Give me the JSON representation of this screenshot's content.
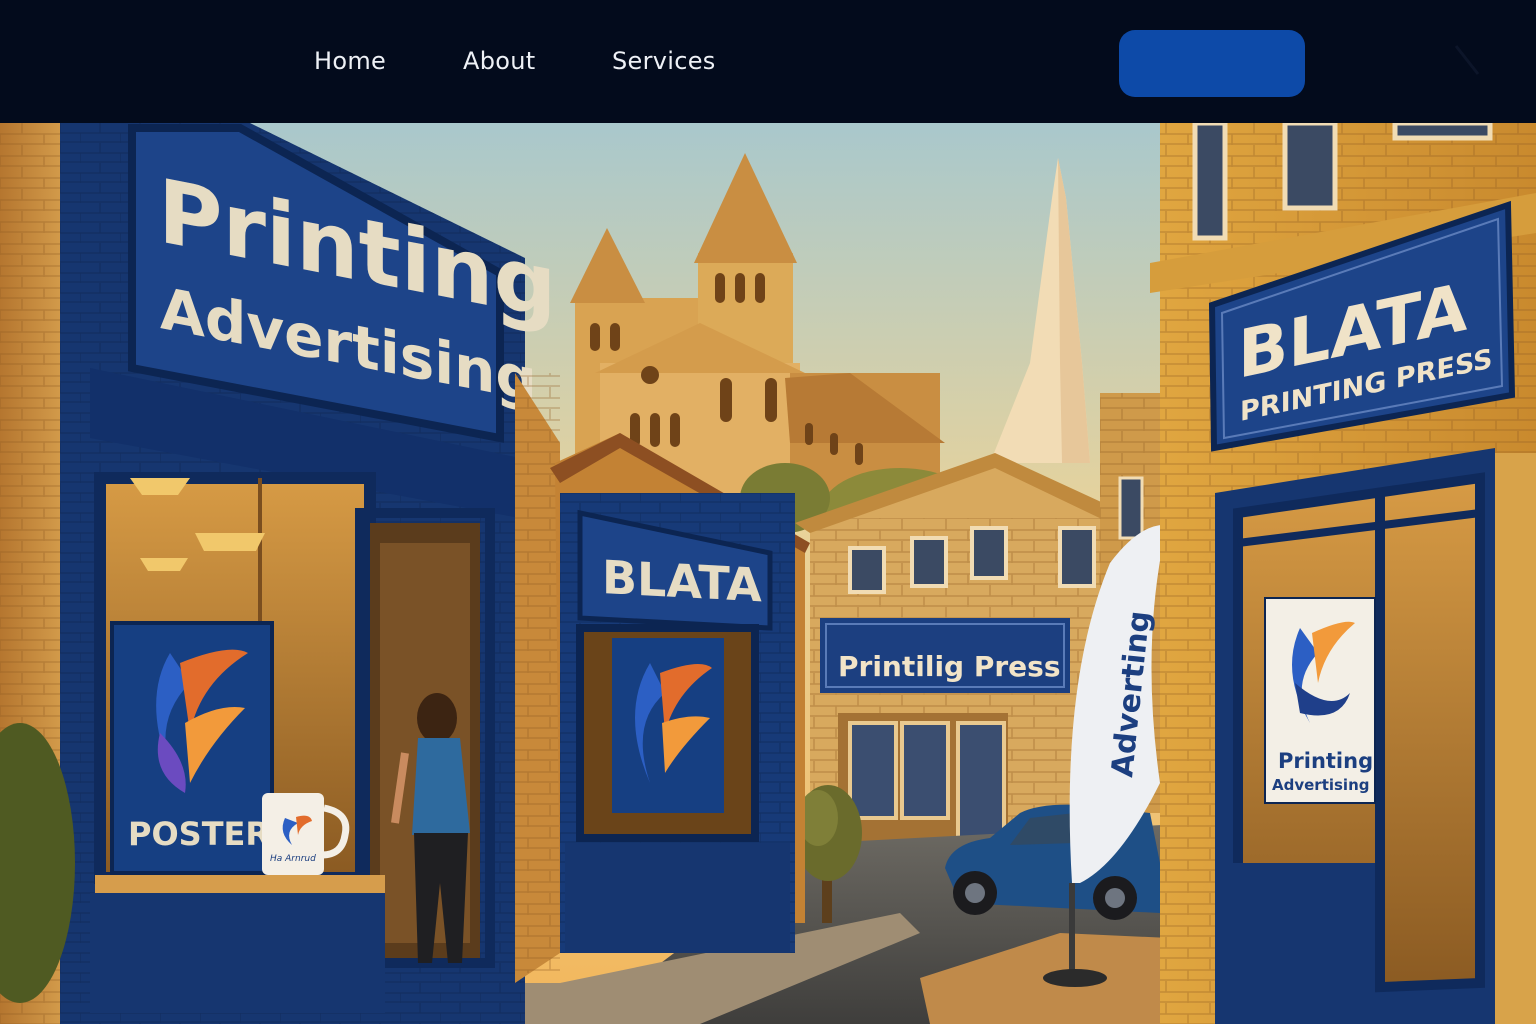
{
  "nav": {
    "links": [
      {
        "label": "Home"
      },
      {
        "label": "About"
      },
      {
        "label": "Services"
      }
    ],
    "cta_label": "",
    "bg_color": "#030b1c",
    "cta_color": "#0d4aa8",
    "menu_icon": "menu-icon"
  },
  "hero": {
    "left_sign": {
      "line1": "Printing",
      "line2": "Advertising"
    },
    "left_poster": {
      "label": "POSTER",
      "icon": "flame-leaf-logo"
    },
    "mug": {
      "label": "Ha Arnrud",
      "icon": "mug-logo"
    },
    "center_sign": {
      "label": "BLATA"
    },
    "small_shop_sign": {
      "label": "Printilig Press"
    },
    "flag": {
      "label": "Adverting"
    },
    "right_sign": {
      "line1": "BLATA",
      "line2": "PRINTING PRESS"
    },
    "right_poster": {
      "line1": "Printing",
      "line2": "Advertising"
    }
  },
  "colors": {
    "sign_blue": "#173a78",
    "sign_text": "#e6dcc3",
    "brick": "#c8893a",
    "sky_top": "#a7c6cc",
    "sky_bottom": "#f0c56a"
  }
}
